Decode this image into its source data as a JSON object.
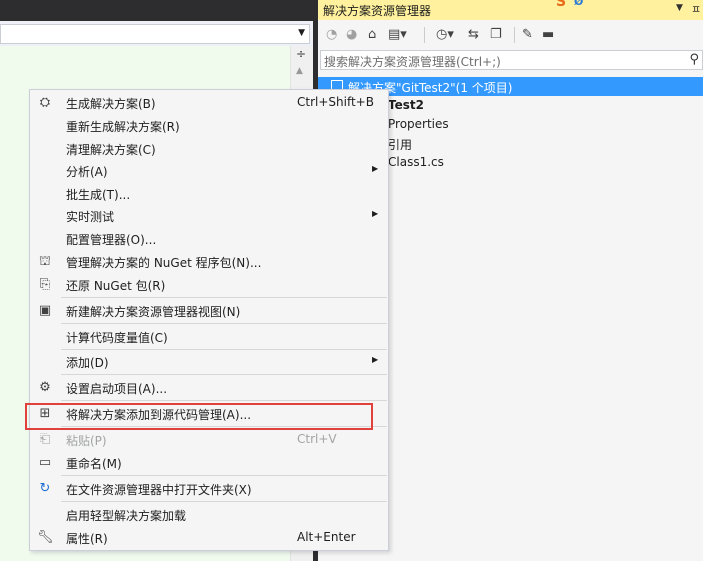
{
  "colors": {
    "menu_background": "#f5f5f5",
    "selection_blue": "#3399ff",
    "title_yellow": "#fff19d",
    "editor_green": "#f0fbee",
    "highlight_red": "#e0413c",
    "disabled_gray": "#a2a4a5"
  },
  "editor": {
    "split_icon": "split-window-icon"
  },
  "solution_explorer": {
    "title": "解决方案资源管理器",
    "search_placeholder": "搜索解决方案资源管理器(Ctrl+;)",
    "toolbar_icons": [
      "back-icon",
      "forward-icon",
      "home-icon",
      "switch-views-icon",
      "history-icon",
      "sync-icon",
      "collapse-all-icon",
      "properties-wrench-icon",
      "preview-icon"
    ],
    "tree": [
      {
        "text": "解决方案\"GitTest2\"(1 个项目)",
        "selected": true
      },
      {
        "text": "Test2",
        "bold": true
      },
      {
        "text": "Properties"
      },
      {
        "text": "引用"
      },
      {
        "text": "Class1.cs"
      }
    ]
  },
  "context_menu": {
    "items": [
      {
        "label": "生成解决方案(B)",
        "shortcut": "Ctrl+Shift+B",
        "icon": "build-solution-icon"
      },
      {
        "label": "重新生成解决方案(R)"
      },
      {
        "label": "清理解决方案(C)"
      },
      {
        "label": "分析(A)",
        "submenu": true
      },
      {
        "label": "批生成(T)..."
      },
      {
        "label": "实时测试",
        "submenu": true
      },
      {
        "label": "配置管理器(O)..."
      },
      {
        "label": "管理解决方案的 NuGet 程序包(N)...",
        "icon": "nuget-package-icon"
      },
      {
        "label": "还原 NuGet 包(R)",
        "icon": "restore-package-icon"
      },
      {
        "label": "新建解决方案资源管理器视图(N)",
        "icon": "new-view-icon"
      },
      {
        "label": "计算代码度量值(C)"
      },
      {
        "label": "添加(D)",
        "submenu": true
      },
      {
        "label": "设置启动项目(A)...",
        "icon": "gear-icon"
      },
      {
        "label": "将解决方案添加到源代码管理(A)...",
        "icon": "add-source-control-icon",
        "highlighted": true
      },
      {
        "label": "粘贴(P)",
        "shortcut": "Ctrl+V",
        "icon": "paste-icon",
        "disabled": true
      },
      {
        "label": "重命名(M)",
        "icon": "rename-icon"
      },
      {
        "label": "在文件资源管理器中打开文件夹(X)",
        "icon": "refresh-arrow-icon"
      },
      {
        "label": "启用轻型解决方案加载"
      },
      {
        "label": "属性(R)",
        "shortcut": "Alt+Enter",
        "icon": "wrench-icon"
      }
    ]
  }
}
